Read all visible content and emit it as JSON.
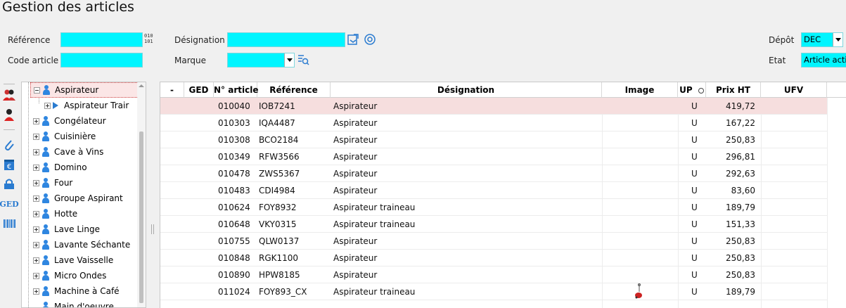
{
  "title": "Gestion des articles",
  "filters": {
    "reference_label": "Référence",
    "reference_value": "",
    "code_label": "Code article",
    "code_value": "",
    "designation_label": "Désignation",
    "designation_value": "",
    "marque_label": "Marque",
    "marque_value": "",
    "depot_label": "Dépôt",
    "depot_value": "DEC",
    "etat_label": "Etat",
    "etat_value": "Article actif"
  },
  "toolbar": {
    "icons": [
      "users-icon",
      "user-icon",
      "paperclip-icon",
      "euro-calendar-icon",
      "lock-icon",
      "ged-icon",
      "barcode-icon"
    ],
    "ged_text": "GED"
  },
  "tree": {
    "items": [
      {
        "label": "Aspirateur",
        "state": "expanded",
        "selected": true
      },
      {
        "label": "Aspirateur Trair",
        "state": "child"
      },
      {
        "label": "Congélateur",
        "state": "collapsed"
      },
      {
        "label": "Cuisinière",
        "state": "collapsed"
      },
      {
        "label": "Cave à Vins",
        "state": "collapsed"
      },
      {
        "label": "Domino",
        "state": "collapsed"
      },
      {
        "label": "Four",
        "state": "collapsed"
      },
      {
        "label": "Groupe Aspirant",
        "state": "collapsed"
      },
      {
        "label": "Hotte",
        "state": "collapsed"
      },
      {
        "label": "Lave Linge",
        "state": "collapsed"
      },
      {
        "label": "Lavante Séchante",
        "state": "collapsed"
      },
      {
        "label": "Lave Vaisselle",
        "state": "collapsed"
      },
      {
        "label": "Micro Ondes",
        "state": "collapsed"
      },
      {
        "label": "Machine à Café",
        "state": "collapsed"
      },
      {
        "label": "Main d'oeuvre",
        "state": "leaf"
      }
    ]
  },
  "grid": {
    "columns": {
      "dash": "-",
      "ged": "GED",
      "num": "N° article",
      "ref": "Référence",
      "des": "Désignation",
      "img": "Image",
      "up": "UP",
      "prix": "Prix HT",
      "ufv": "UFV"
    },
    "rows": [
      {
        "num": "010040",
        "ref": "IOB7241",
        "des": "Aspirateur",
        "img": "",
        "up": "U",
        "prix": "419,72",
        "selected": true
      },
      {
        "num": "010303",
        "ref": "IQA4487",
        "des": "Aspirateur",
        "img": "",
        "up": "U",
        "prix": "167,22"
      },
      {
        "num": "010308",
        "ref": "BCO2184",
        "des": "Aspirateur",
        "img": "",
        "up": "U",
        "prix": "250,83"
      },
      {
        "num": "010349",
        "ref": "RFW3566",
        "des": "Aspirateur",
        "img": "",
        "up": "U",
        "prix": "296,81"
      },
      {
        "num": "010478",
        "ref": "ZWS5367",
        "des": "Aspirateur",
        "img": "",
        "up": "U",
        "prix": "292,63"
      },
      {
        "num": "010483",
        "ref": "CDI4984",
        "des": "Aspirateur",
        "img": "",
        "up": "U",
        "prix": "83,60"
      },
      {
        "num": "010624",
        "ref": "FOY8932",
        "des": "Aspirateur traineau",
        "img": "",
        "up": "U",
        "prix": "189,79"
      },
      {
        "num": "010648",
        "ref": "VKY0315",
        "des": "Aspirateur traineau",
        "img": "",
        "up": "U",
        "prix": "151,33"
      },
      {
        "num": "010755",
        "ref": "QLW0137",
        "des": "Aspirateur",
        "img": "",
        "up": "U",
        "prix": "250,83"
      },
      {
        "num": "010848",
        "ref": "RGK1100",
        "des": "Aspirateur",
        "img": "",
        "up": "U",
        "prix": "250,83"
      },
      {
        "num": "010890",
        "ref": "HPW8185",
        "des": "Aspirateur",
        "img": "",
        "up": "U",
        "prix": "250,83"
      },
      {
        "num": "011024",
        "ref": "FOY893_CX",
        "des": "Aspirateur traineau",
        "img": "vacuum-thumbnail",
        "up": "U",
        "prix": "189,79"
      }
    ]
  }
}
